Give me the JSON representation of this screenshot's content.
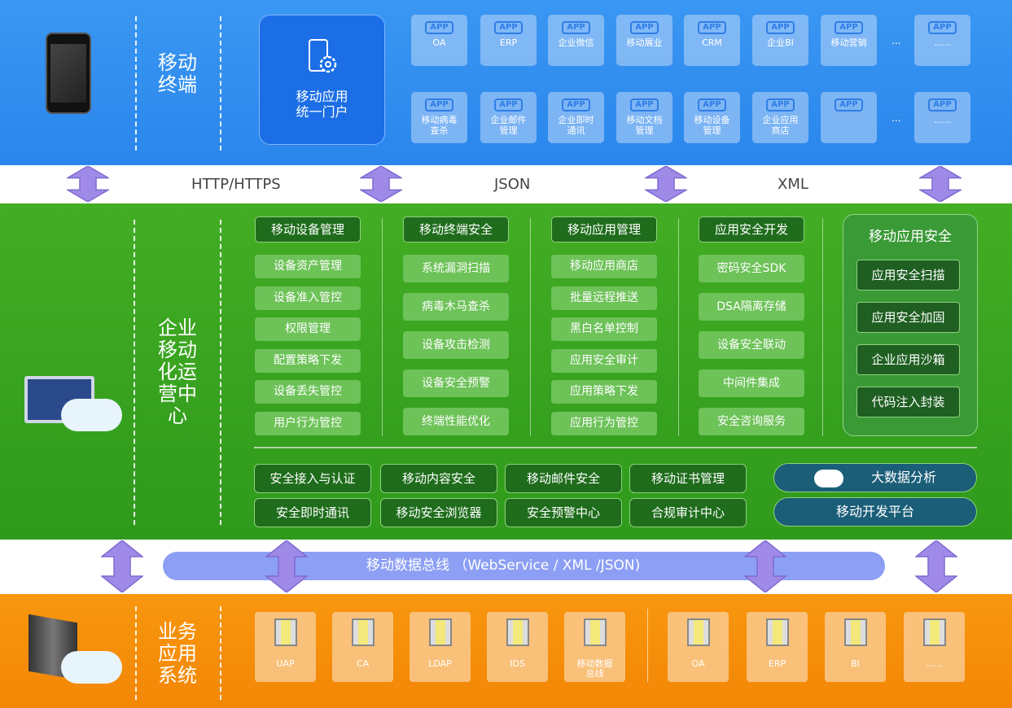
{
  "terminal": {
    "label": "移动\n终端",
    "portal": "移动应用\n统一门户",
    "apps_row1": [
      "OA",
      "ERP",
      "企业微信",
      "移动展业",
      "CRM",
      "企业BI",
      "移动营销"
    ],
    "apps_row2": [
      "移动病毒\n查杀",
      "企业邮件\n管理",
      "企业即时\n通讯",
      "移动文档\n管理",
      "移动设备\n管理",
      "企业应用\n商店",
      ""
    ],
    "app_tag": "APP",
    "ellipsis": "...",
    "more": "......"
  },
  "protocols": [
    "HTTP/HTTPS",
    "JSON",
    "XML"
  ],
  "ops": {
    "label": "企业\n移动\n化运\n营中\n心",
    "columns": [
      {
        "header": "移动设备管理",
        "items": [
          "设备资产管理",
          "设备准入管控",
          "权限管理",
          "配置策略下发",
          "设备丢失管控",
          "用户行为管控"
        ]
      },
      {
        "header": "移动终端安全",
        "items": [
          "系统漏洞扫描",
          "病毒木马查杀",
          "设备攻击检测",
          "设备安全预警",
          "终端性能优化"
        ]
      },
      {
        "header": "移动应用管理",
        "items": [
          "移动应用商店",
          "批量远程推送",
          "黑白名单控制",
          "应用安全审计",
          "应用策略下发",
          "应用行为管控"
        ]
      },
      {
        "header": "应用安全开发",
        "items": [
          "密码安全SDK",
          "DSA隔离存储",
          "设备安全联动",
          "中间件集成",
          "安全咨询服务"
        ]
      }
    ],
    "app_security": {
      "title": "移动应用安全",
      "items": [
        "应用安全扫描",
        "应用安全加固",
        "企业应用沙箱",
        "代码注入封装"
      ]
    },
    "bottom_row1": [
      "安全接入与认证",
      "移动内容安全",
      "移动邮件安全",
      "移动证书管理"
    ],
    "bottom_row2": [
      "安全即时通讯",
      "移动安全浏览器",
      "安全预警中心",
      "合规审计中心"
    ],
    "big_data": "大数据分析",
    "dev_platform": "移动开发平台"
  },
  "bus": "移动数据总线 （WebService / XML /JSON)",
  "business": {
    "label": "业务\n应用\n系统",
    "left": [
      "UAP",
      "CA",
      "LDAP",
      "IDS",
      "移动数据\n总线"
    ],
    "right": [
      "OA",
      "ERP",
      "BI",
      "......"
    ]
  },
  "colors": {
    "blue": "#2a86ec",
    "green": "#3aa520",
    "orange": "#f68c0a",
    "arrow": "#a08ae8"
  }
}
